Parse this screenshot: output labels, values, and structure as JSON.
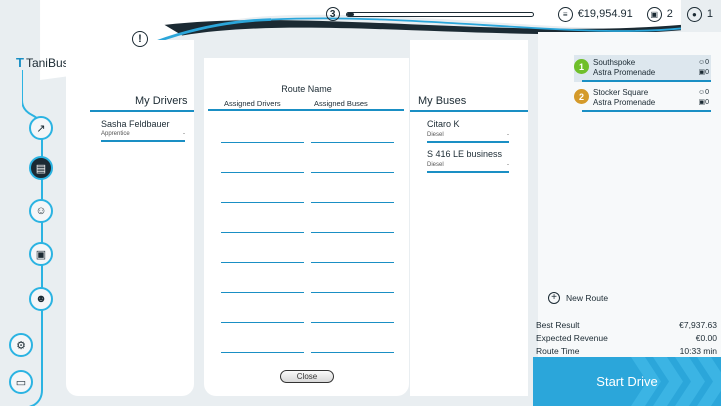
{
  "app": {
    "name": "TaniBus"
  },
  "topbar": {
    "level": "3",
    "xp_fraction": 0.04,
    "money": "€19,954.91",
    "buses_count": "2",
    "drivers_count": "1"
  },
  "icons": {
    "alert": "exclamation-icon",
    "nav": [
      "statistics-icon",
      "map-icon",
      "driver-icon",
      "bus-icon",
      "people-icon",
      "settings-gears-icon",
      "computer-icon"
    ]
  },
  "alert_text": "!",
  "drivers": {
    "title": "My Drivers",
    "items": [
      {
        "name": "Sasha Feldbauer",
        "level": "Apprentice",
        "value": "-"
      }
    ]
  },
  "route": {
    "name": "Route Name",
    "assigned_drivers_label": "Assigned Drivers",
    "assigned_buses_label": "Assigned Buses",
    "slot_rows": 8
  },
  "buses": {
    "title": "My Buses",
    "items": [
      {
        "name": "Citaro K",
        "fuel": "Diesel",
        "value": "-"
      },
      {
        "name": "S 416 LE business",
        "fuel": "Diesel",
        "value": "-"
      }
    ]
  },
  "close_label": "Close",
  "routes_list": [
    {
      "number": "1",
      "color": "#6fbf2a",
      "from": "Southspoke",
      "to": "Astra Promenade",
      "drivers": "0",
      "buses": "0",
      "selected": true
    },
    {
      "number": "2",
      "color": "#d49a2a",
      "from": "Stocker Square",
      "to": "Astra Promenade",
      "drivers": "0",
      "buses": "0",
      "selected": false
    }
  ],
  "new_route_label": "New Route",
  "summary": {
    "best_result_label": "Best Result",
    "best_result_value": "€7,937.63",
    "expected_revenue_label": "Expected Revenue",
    "expected_revenue_value": "€0.00",
    "route_time_label": "Route Time",
    "route_time_value": "10:33 min"
  },
  "start_drive_label": "Start Drive",
  "colors": {
    "accent": "#2ba6da",
    "line": "#1a8fc4",
    "dark": "#1b2a33"
  }
}
